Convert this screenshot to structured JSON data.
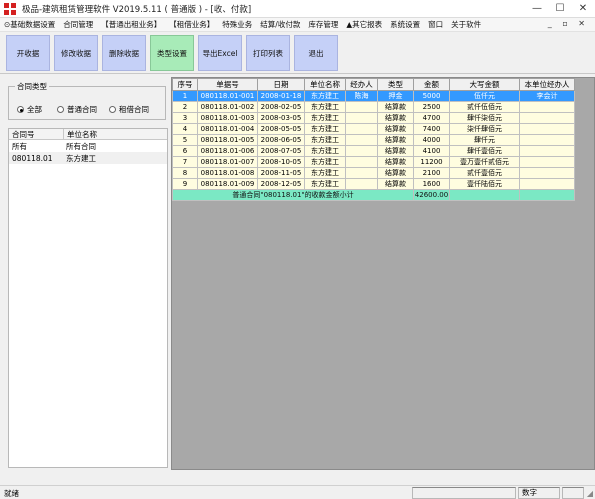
{
  "window": {
    "title": "极品-建筑租赁管理软件 V2019.5.11 ( 普通版 ) - [收、付款]",
    "minimize": "—",
    "maximize": "☐",
    "close": "✕"
  },
  "menu": {
    "items": [
      "⊙基础数据设置",
      "合同管理",
      "【普通出租业务】",
      "【租借业务】",
      "特殊业务",
      "结算/收付款",
      "库存管理",
      "▲其它报表",
      "系统设置",
      "窗口",
      "关于软件"
    ],
    "mdi_controls": "_ ▫ ✕"
  },
  "toolbar": {
    "buttons": [
      "开收据",
      "修改收据",
      "删除收据",
      "类型设置",
      "导出Excel",
      "打印列表",
      "退出"
    ]
  },
  "left": {
    "contract_type_label": "合同类型",
    "radios": [
      "全部",
      "普通合同",
      "租借合同"
    ],
    "list_headers": [
      "合同号",
      "单位名称"
    ],
    "list_rows": [
      [
        "所有",
        "所有合同"
      ],
      [
        "080118.01",
        "东方建工"
      ]
    ]
  },
  "grid": {
    "headers": [
      "序号",
      "单据号",
      "日期",
      "单位名称",
      "经办人",
      "类型",
      "金额",
      "大写金额",
      "本单位经办人"
    ],
    "rows": [
      [
        "1",
        "080118.01-001",
        "2008-01-18",
        "东方建工",
        "陈海",
        "押金",
        "5000",
        "伍仟元",
        "李会计"
      ],
      [
        "2",
        "080118.01-002",
        "2008-02-05",
        "东方建工",
        "",
        "结算款",
        "2500",
        "贰仟伍佰元",
        ""
      ],
      [
        "3",
        "080118.01-003",
        "2008-03-05",
        "东方建工",
        "",
        "结算款",
        "4700",
        "肆仟柒佰元",
        ""
      ],
      [
        "4",
        "080118.01-004",
        "2008-05-05",
        "东方建工",
        "",
        "结算款",
        "7400",
        "柒仟肆佰元",
        ""
      ],
      [
        "5",
        "080118.01-005",
        "2008-06-05",
        "东方建工",
        "",
        "结算款",
        "4000",
        "肆仟元",
        ""
      ],
      [
        "6",
        "080118.01-006",
        "2008-07-05",
        "东方建工",
        "",
        "结算款",
        "4100",
        "肆仟壹佰元",
        ""
      ],
      [
        "7",
        "080118.01-007",
        "2008-10-05",
        "东方建工",
        "",
        "结算款",
        "11200",
        "壹万壹仟贰佰元",
        ""
      ],
      [
        "8",
        "080118.01-008",
        "2008-11-05",
        "东方建工",
        "",
        "结算款",
        "2100",
        "贰仟壹佰元",
        ""
      ],
      [
        "9",
        "080118.01-009",
        "2008-12-05",
        "东方建工",
        "",
        "结算款",
        "1600",
        "壹仟陆佰元",
        ""
      ]
    ],
    "summary_label": "普通合同\"080118.01\"的收款金额小计",
    "summary_amount": "42600.00"
  },
  "status": {
    "left": "就绪",
    "num": "数字"
  },
  "colors": {
    "toolbar_button": "#c5d0f7",
    "toolbar_active": "#a8ebb8",
    "row_selected": "#3399ff",
    "row_bg": "#fffde0",
    "summary_bg": "#7be8c4"
  }
}
